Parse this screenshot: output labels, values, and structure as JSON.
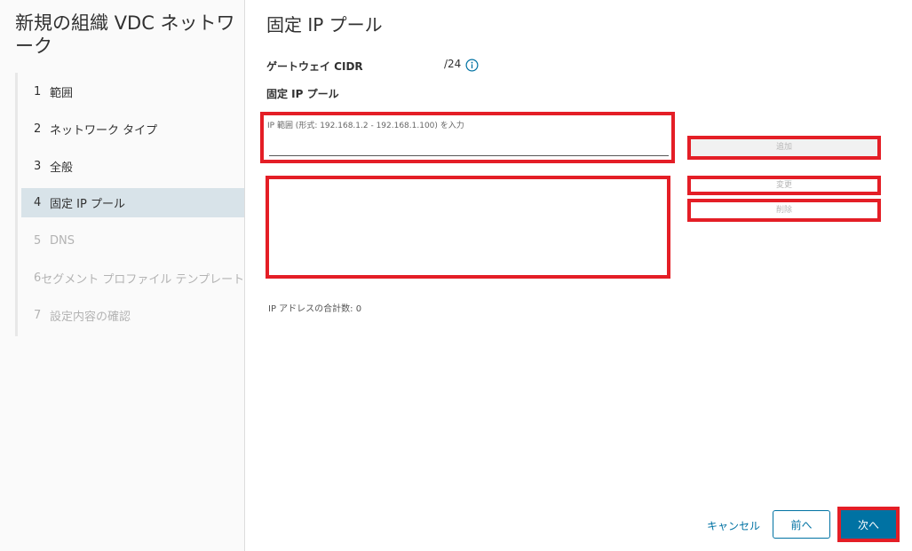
{
  "wizard": {
    "title": "新規の組織 VDC ネットワーク",
    "steps": [
      {
        "num": "1",
        "label": "範囲",
        "state": "done"
      },
      {
        "num": "2",
        "label": "ネットワーク タイプ",
        "state": "done"
      },
      {
        "num": "3",
        "label": "全般",
        "state": "done"
      },
      {
        "num": "4",
        "label": "固定 IP プール",
        "state": "active"
      },
      {
        "num": "5",
        "label": "DNS",
        "state": "disabled"
      },
      {
        "num": "6",
        "label": "セグメント プロファイル テンプレート",
        "state": "disabled"
      },
      {
        "num": "7",
        "label": "設定内容の確認",
        "state": "disabled"
      }
    ]
  },
  "page": {
    "title": "固定 IP プール",
    "gateway_cidr_label": "ゲートウェイ CIDR",
    "gateway_cidr_value": "/24",
    "static_pool_label": "固定 IP プール",
    "ip_range_placeholder": "IP 範囲 (形式: 192.168.1.2 - 192.168.1.100) を入力",
    "ip_range_value": "",
    "add_label": "追加",
    "edit_label": "変更",
    "delete_label": "削除",
    "total_text": "IP アドレスの合計数: 0"
  },
  "footer": {
    "cancel_label": "キャンセル",
    "prev_label": "前へ",
    "next_label": "次へ"
  },
  "colors": {
    "accent": "#0072a3",
    "done_step": "#62a420",
    "active_step_bg": "#d8e3e9",
    "highlight": "#e41e26"
  }
}
